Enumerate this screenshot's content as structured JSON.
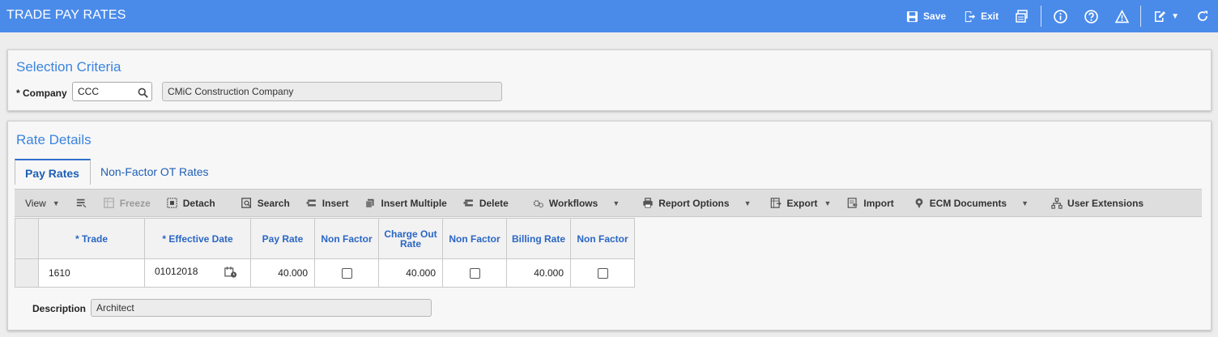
{
  "header": {
    "title": "TRADE PAY RATES",
    "save_label": "Save",
    "exit_label": "Exit"
  },
  "selection": {
    "title": "Selection Criteria",
    "company_label": "* Company",
    "company_value": "CCC",
    "company_name": "CMiC Construction Company"
  },
  "rate_details": {
    "title": "Rate Details",
    "tabs": [
      "Pay Rates",
      "Non-Factor OT Rates"
    ],
    "toolbar": {
      "view": "View",
      "freeze": "Freeze",
      "detach": "Detach",
      "search": "Search",
      "insert": "Insert",
      "insert_multiple": "Insert Multiple",
      "delete": "Delete",
      "workflows": "Workflows",
      "report_options": "Report Options",
      "export": "Export",
      "import": "Import",
      "ecm_documents": "ECM Documents",
      "user_extensions": "User Extensions"
    },
    "columns": [
      "* Trade",
      "* Effective Date",
      "Pay Rate",
      "Non Factor",
      "Charge Out Rate",
      "Non Factor",
      "Billing Rate",
      "Non Factor"
    ],
    "rows": [
      {
        "trade": "1610",
        "effective_date": "01012018",
        "pay_rate": "40.000",
        "charge_out_rate": "40.000",
        "billing_rate": "40.000"
      }
    ],
    "description_label": "Description",
    "description_value": "Architect"
  },
  "colors": {
    "header_bg": "#4a8bea",
    "accent_text": "#3a84de",
    "link_text": "#1f5fb4"
  }
}
